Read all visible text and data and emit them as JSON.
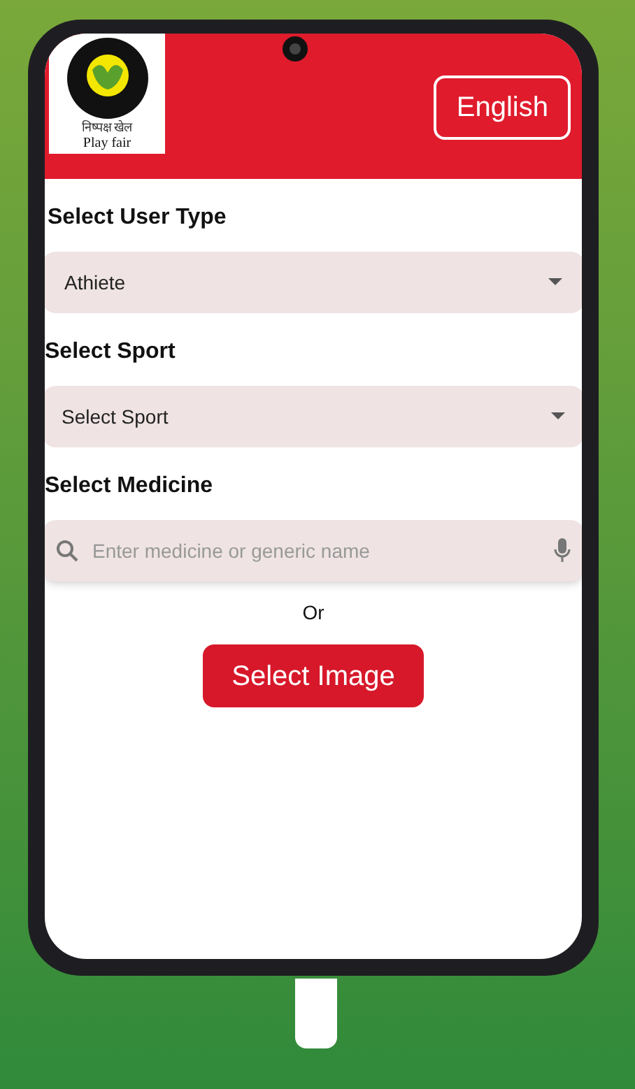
{
  "header": {
    "logo": {
      "caption_hindi": "निष्पक्ष खेल",
      "caption": "Play fair"
    },
    "language_button": "English"
  },
  "user_type": {
    "label": "Select User Type",
    "value": "Athiete"
  },
  "sport": {
    "label": "Select Sport",
    "placeholder": "Select Sport"
  },
  "medicine": {
    "label": "Select Medicine",
    "placeholder": "Enter medicine or generic name"
  },
  "separator": "Or",
  "select_image_button": "Select Image"
}
